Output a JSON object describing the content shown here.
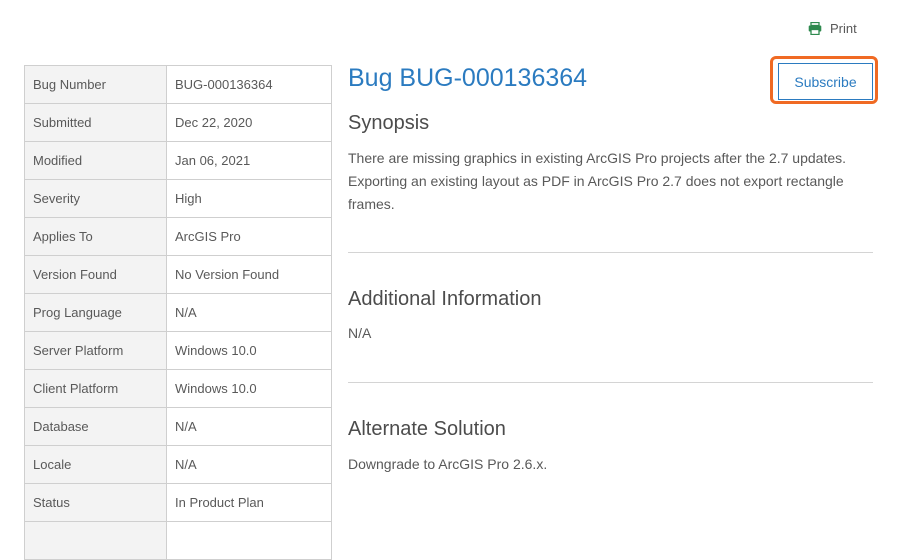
{
  "print_label": "Print",
  "title": "Bug BUG-000136364",
  "subscribe_label": "Subscribe",
  "details": [
    {
      "key": "Bug Number",
      "value": "BUG-000136364"
    },
    {
      "key": "Submitted",
      "value": "Dec 22, 2020"
    },
    {
      "key": "Modified",
      "value": "Jan 06, 2021"
    },
    {
      "key": "Severity",
      "value": "High"
    },
    {
      "key": "Applies To",
      "value": "ArcGIS Pro"
    },
    {
      "key": "Version Found",
      "value": "No Version Found"
    },
    {
      "key": "Prog Language",
      "value": "N/A"
    },
    {
      "key": "Server Platform",
      "value": "Windows 10.0"
    },
    {
      "key": "Client Platform",
      "value": "Windows 10.0"
    },
    {
      "key": "Database",
      "value": "N/A"
    },
    {
      "key": "Locale",
      "value": "N/A"
    },
    {
      "key": "Status",
      "value": "In Product Plan"
    },
    {
      "key": "",
      "value": ""
    }
  ],
  "synopsis": {
    "heading": "Synopsis",
    "text": "There are missing graphics in existing ArcGIS Pro projects after the 2.7 updates. Exporting an existing layout as PDF in ArcGIS Pro 2.7 does not export rectangle frames."
  },
  "additional": {
    "heading": "Additional Information",
    "text": "N/A"
  },
  "alternate": {
    "heading": "Alternate Solution",
    "text": "Downgrade to ArcGIS Pro 2.6.x."
  },
  "accent_color": "#2b7bc0",
  "highlight_color": "#f06a23"
}
